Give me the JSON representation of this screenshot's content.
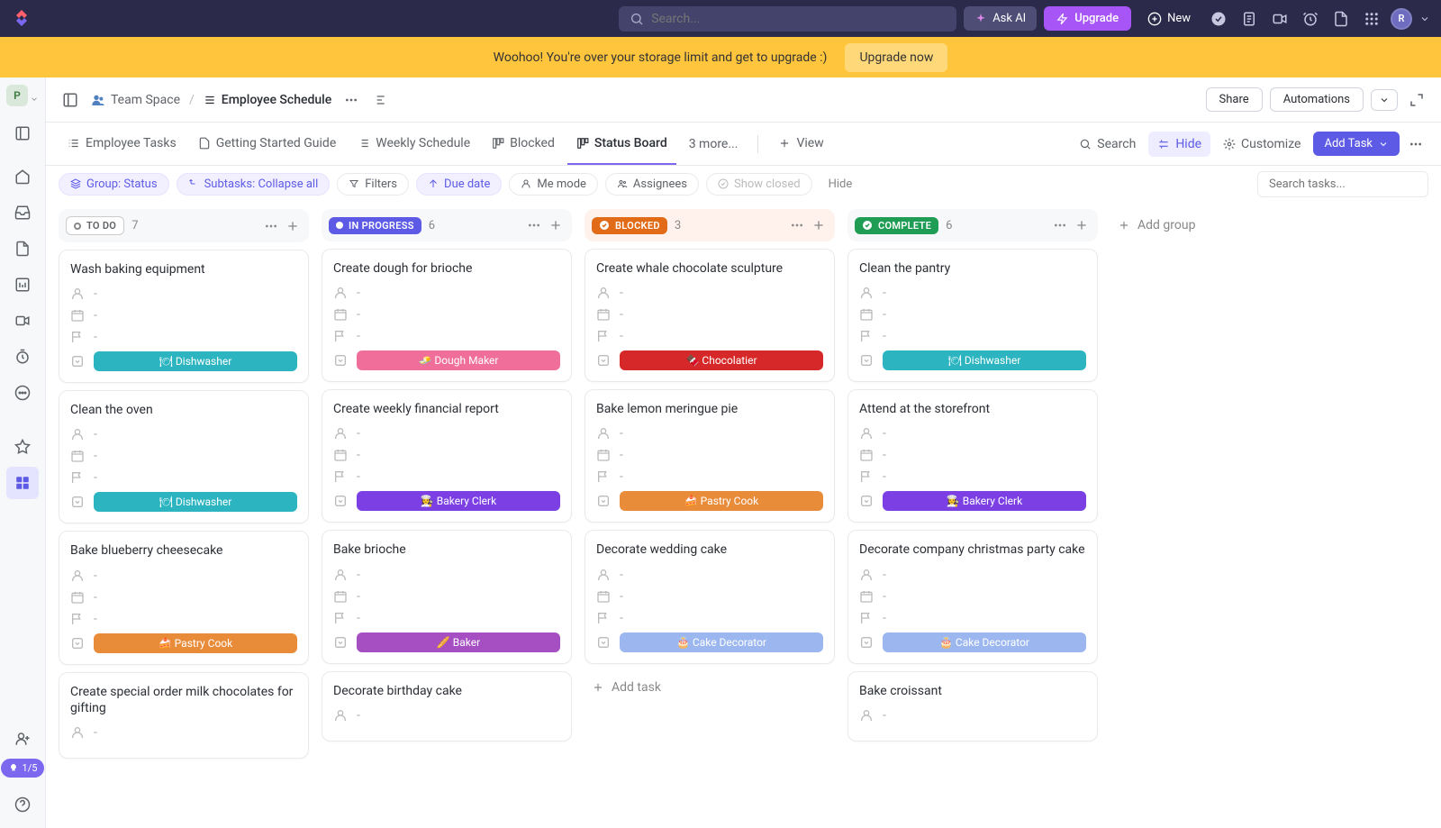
{
  "topbar": {
    "search_placeholder": "Search...",
    "ask_ai": "Ask AI",
    "upgrade": "Upgrade",
    "new": "New",
    "avatar": "R"
  },
  "banner": {
    "text": "Woohoo! You're over your storage limit and get to upgrade :)",
    "cta": "Upgrade now"
  },
  "sidebar": {
    "workspace": "P",
    "progress": "1/5"
  },
  "breadcrumbs": {
    "space": "Team Space",
    "page": "Employee Schedule",
    "share": "Share",
    "automations": "Automations"
  },
  "views": {
    "tabs": [
      {
        "label": "Employee Tasks"
      },
      {
        "label": "Getting Started Guide"
      },
      {
        "label": "Weekly Schedule"
      },
      {
        "label": "Blocked"
      },
      {
        "label": "Status Board"
      }
    ],
    "more": "3 more...",
    "view": "View",
    "search": "Search",
    "hide": "Hide",
    "customize": "Customize",
    "add_task": "Add Task"
  },
  "filters": {
    "group": "Group: Status",
    "subtasks": "Subtasks: Collapse all",
    "filters": "Filters",
    "due": "Due date",
    "me": "Me mode",
    "assignees": "Assignees",
    "show_closed": "Show closed",
    "hide": "Hide",
    "search_placeholder": "Search tasks..."
  },
  "columns": [
    {
      "key": "todo",
      "label": "TO DO",
      "count": "7",
      "pill": "sp-todo",
      "head_class": ""
    },
    {
      "key": "progress",
      "label": "IN PROGRESS",
      "count": "6",
      "pill": "sp-progress",
      "head_class": ""
    },
    {
      "key": "blocked",
      "label": "BLOCKED",
      "count": "3",
      "pill": "sp-blocked",
      "head_class": "blocked-bg"
    },
    {
      "key": "complete",
      "label": "COMPLETE",
      "count": "6",
      "pill": "sp-complete",
      "head_class": ""
    }
  ],
  "cards": {
    "todo": [
      {
        "title": "Wash baking equipment",
        "role": "🍽 Dishwasher",
        "color": "#2cb5c0"
      },
      {
        "title": "Clean the oven",
        "role": "🍽 Dishwasher",
        "color": "#2cb5c0"
      },
      {
        "title": "Bake blueberry cheesecake",
        "role": "🍰 Pastry Cook",
        "color": "#e98c3a"
      },
      {
        "title": "Create special order milk chocolates for gifting",
        "role": "",
        "color": ""
      }
    ],
    "progress": [
      {
        "title": "Create dough for brioche",
        "role": "🧈 Dough Maker",
        "color": "#ef6f9a"
      },
      {
        "title": "Create weekly financial report",
        "role": "👩‍🍳 Bakery Clerk",
        "color": "#7b3fe4"
      },
      {
        "title": "Bake brioche",
        "role": "🥖 Baker",
        "color": "#a54fc2"
      },
      {
        "title": "Decorate birthday cake",
        "role": "",
        "color": ""
      }
    ],
    "blocked": [
      {
        "title": "Create whale chocolate sculpture",
        "role": "🍫 Chocolatier",
        "color": "#d62828"
      },
      {
        "title": "Bake lemon meringue pie",
        "role": "🍰 Pastry Cook",
        "color": "#e98c3a"
      },
      {
        "title": "Decorate wedding cake",
        "role": "🎂 Cake Decorator",
        "color": "#9cb7f0"
      }
    ],
    "complete": [
      {
        "title": "Clean the pantry",
        "role": "🍽 Dishwasher",
        "color": "#2cb5c0"
      },
      {
        "title": "Attend at the storefront",
        "role": "👩‍🍳 Bakery Clerk",
        "color": "#7b3fe4"
      },
      {
        "title": "Decorate company christmas party cake",
        "role": "🎂 Cake Decorator",
        "color": "#9cb7f0"
      },
      {
        "title": "Bake croissant",
        "role": "",
        "color": ""
      }
    ]
  },
  "add_task_label": "Add task",
  "add_group_label": "Add group"
}
